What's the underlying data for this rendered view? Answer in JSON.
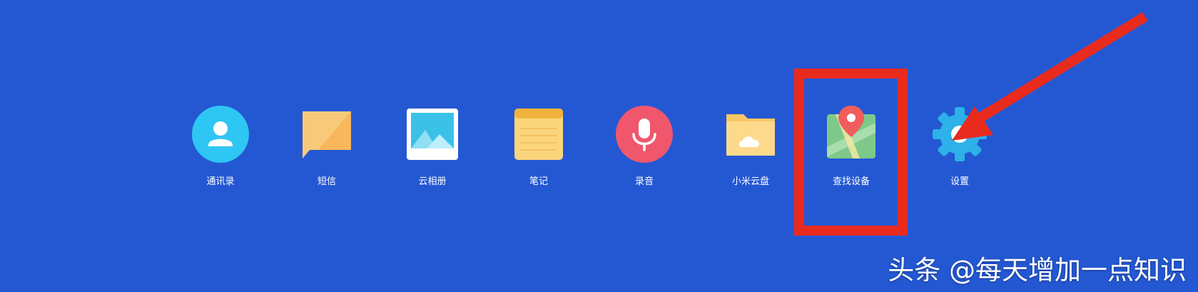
{
  "apps": [
    {
      "id": "contacts",
      "label": "通讯录",
      "icon": "contacts-person-icon"
    },
    {
      "id": "messages",
      "label": "短信",
      "icon": "message-bubble-icon"
    },
    {
      "id": "gallery",
      "label": "云相册",
      "icon": "photo-album-icon"
    },
    {
      "id": "notes",
      "label": "笔记",
      "icon": "notepad-icon"
    },
    {
      "id": "recorder",
      "label": "录音",
      "icon": "microphone-icon"
    },
    {
      "id": "cloud-drive",
      "label": "小米云盘",
      "icon": "cloud-folder-icon"
    },
    {
      "id": "find-device",
      "label": "查找设备",
      "icon": "map-pin-icon"
    },
    {
      "id": "settings",
      "label": "设置",
      "icon": "gear-icon"
    }
  ],
  "annotation": {
    "highlighted_app": "find-device",
    "box_color": "#e92b1e",
    "arrow_color": "#e92b1e"
  },
  "watermark": {
    "text": "头条 @每天增加一点知识"
  },
  "colors": {
    "background": "#2458d3",
    "label_text": "#ffffff"
  }
}
